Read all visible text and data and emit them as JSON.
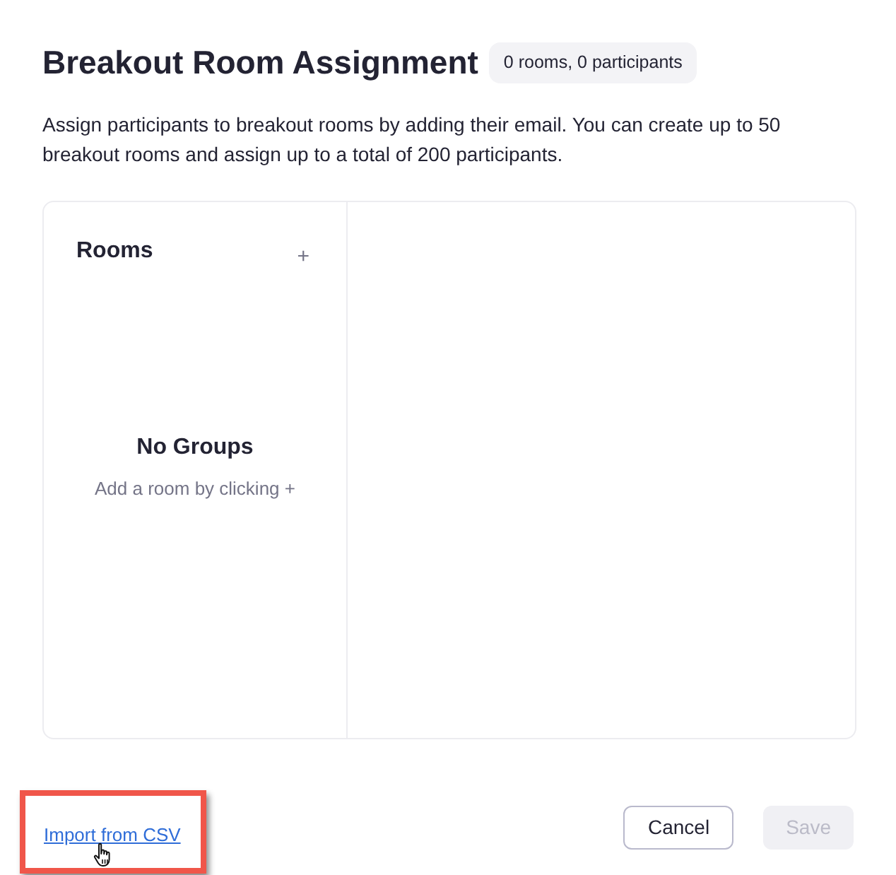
{
  "header": {
    "title": "Breakout Room Assignment",
    "badge": "0 rooms, 0 participants"
  },
  "description": "Assign participants to breakout rooms by adding their email. You can create up to 50 breakout rooms and assign up to a total of 200 participants.",
  "rooms_panel": {
    "title": "Rooms",
    "add_button": "+",
    "empty_state": {
      "title": "No Groups",
      "hint": "Add a room by clicking +"
    }
  },
  "footer": {
    "import_link": {
      "label": "Import from CSV",
      "highlighted": true
    },
    "buttons": [
      {
        "label": "Cancel",
        "disabled": false
      },
      {
        "label": "Save",
        "disabled": true
      }
    ]
  }
}
